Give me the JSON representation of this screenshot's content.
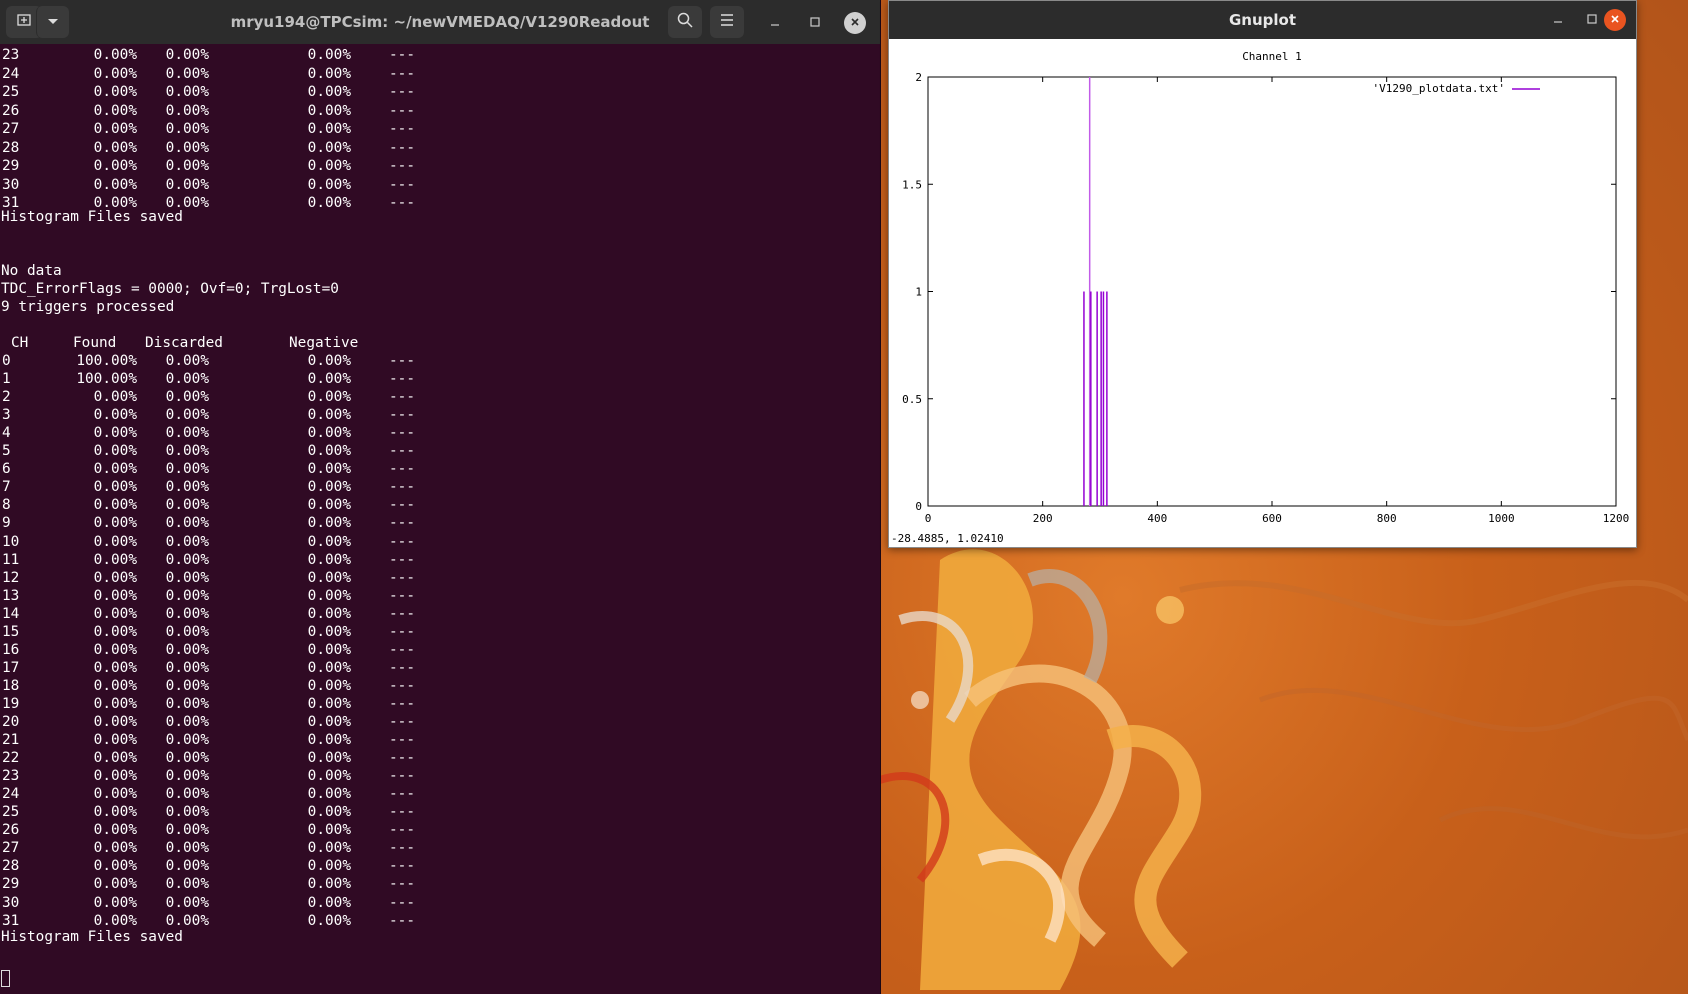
{
  "terminal": {
    "title": "mryu194@TPCsim: ~/newVMEDAQ/V1290Readout",
    "top_rows": [
      [
        "23",
        "0.00%",
        "0.00%",
        "0.00%",
        "---"
      ],
      [
        "24",
        "0.00%",
        "0.00%",
        "0.00%",
        "---"
      ],
      [
        "25",
        "0.00%",
        "0.00%",
        "0.00%",
        "---"
      ],
      [
        "26",
        "0.00%",
        "0.00%",
        "0.00%",
        "---"
      ],
      [
        "27",
        "0.00%",
        "0.00%",
        "0.00%",
        "---"
      ],
      [
        "28",
        "0.00%",
        "0.00%",
        "0.00%",
        "---"
      ],
      [
        "29",
        "0.00%",
        "0.00%",
        "0.00%",
        "---"
      ],
      [
        "30",
        "0.00%",
        "0.00%",
        "0.00%",
        "---"
      ],
      [
        "31",
        "0.00%",
        "0.00%",
        "0.00%",
        "---"
      ]
    ],
    "saved_msg_1": "Histogram Files saved",
    "no_data": "No data",
    "error_flags": "TDC_ErrorFlags = 0000; Ovf=0; TrgLost=0",
    "triggers": "9 triggers processed",
    "headers": [
      "CH",
      "Found",
      "Discarded",
      "Negative"
    ],
    "rows": [
      [
        "0",
        "100.00%",
        "0.00%",
        "0.00%",
        "---"
      ],
      [
        "1",
        "100.00%",
        "0.00%",
        "0.00%",
        "---"
      ],
      [
        "2",
        "0.00%",
        "0.00%",
        "0.00%",
        "---"
      ],
      [
        "3",
        "0.00%",
        "0.00%",
        "0.00%",
        "---"
      ],
      [
        "4",
        "0.00%",
        "0.00%",
        "0.00%",
        "---"
      ],
      [
        "5",
        "0.00%",
        "0.00%",
        "0.00%",
        "---"
      ],
      [
        "6",
        "0.00%",
        "0.00%",
        "0.00%",
        "---"
      ],
      [
        "7",
        "0.00%",
        "0.00%",
        "0.00%",
        "---"
      ],
      [
        "8",
        "0.00%",
        "0.00%",
        "0.00%",
        "---"
      ],
      [
        "9",
        "0.00%",
        "0.00%",
        "0.00%",
        "---"
      ],
      [
        "10",
        "0.00%",
        "0.00%",
        "0.00%",
        "---"
      ],
      [
        "11",
        "0.00%",
        "0.00%",
        "0.00%",
        "---"
      ],
      [
        "12",
        "0.00%",
        "0.00%",
        "0.00%",
        "---"
      ],
      [
        "13",
        "0.00%",
        "0.00%",
        "0.00%",
        "---"
      ],
      [
        "14",
        "0.00%",
        "0.00%",
        "0.00%",
        "---"
      ],
      [
        "15",
        "0.00%",
        "0.00%",
        "0.00%",
        "---"
      ],
      [
        "16",
        "0.00%",
        "0.00%",
        "0.00%",
        "---"
      ],
      [
        "17",
        "0.00%",
        "0.00%",
        "0.00%",
        "---"
      ],
      [
        "18",
        "0.00%",
        "0.00%",
        "0.00%",
        "---"
      ],
      [
        "19",
        "0.00%",
        "0.00%",
        "0.00%",
        "---"
      ],
      [
        "20",
        "0.00%",
        "0.00%",
        "0.00%",
        "---"
      ],
      [
        "21",
        "0.00%",
        "0.00%",
        "0.00%",
        "---"
      ],
      [
        "22",
        "0.00%",
        "0.00%",
        "0.00%",
        "---"
      ],
      [
        "23",
        "0.00%",
        "0.00%",
        "0.00%",
        "---"
      ],
      [
        "24",
        "0.00%",
        "0.00%",
        "0.00%",
        "---"
      ],
      [
        "25",
        "0.00%",
        "0.00%",
        "0.00%",
        "---"
      ],
      [
        "26",
        "0.00%",
        "0.00%",
        "0.00%",
        "---"
      ],
      [
        "27",
        "0.00%",
        "0.00%",
        "0.00%",
        "---"
      ],
      [
        "28",
        "0.00%",
        "0.00%",
        "0.00%",
        "---"
      ],
      [
        "29",
        "0.00%",
        "0.00%",
        "0.00%",
        "---"
      ],
      [
        "30",
        "0.00%",
        "0.00%",
        "0.00%",
        "---"
      ],
      [
        "31",
        "0.00%",
        "0.00%",
        "0.00%",
        "---"
      ]
    ],
    "saved_msg_2": "Histogram Files saved",
    "icons": {
      "new_tab": "new-tab-icon",
      "dropdown": "chevron-down-icon",
      "search": "search-icon",
      "menu": "hamburger-menu-icon",
      "minimize": "minimize-icon",
      "maximize": "maximize-icon",
      "close": "close-icon"
    },
    "colors": {
      "background": "#300a24",
      "text": "#ffffff",
      "titlebar": "#2c2c2c"
    }
  },
  "gnuplot": {
    "window_title": "Gnuplot",
    "status": "-28.4885,  1.02410",
    "colors": {
      "series": "#9400d3",
      "accent_close": "#e95420"
    }
  },
  "chart_data": {
    "type": "bar",
    "title": "Channel 1",
    "xlabel": "",
    "ylabel": "",
    "xlim": [
      0,
      1200
    ],
    "ylim": [
      0,
      2
    ],
    "x_ticks": [
      "0",
      "200",
      "400",
      "600",
      "800",
      "1000",
      "1200"
    ],
    "y_ticks": [
      "0",
      "0.5",
      "1",
      "1.5",
      "2"
    ],
    "grid": false,
    "legend_position": "top-right",
    "series": [
      {
        "name": "'V1290_plotdata.txt'",
        "x": [
          272,
          282,
          284,
          295,
          302,
          306,
          312
        ],
        "values": [
          1,
          2,
          1,
          1,
          1,
          1,
          1
        ]
      }
    ]
  }
}
